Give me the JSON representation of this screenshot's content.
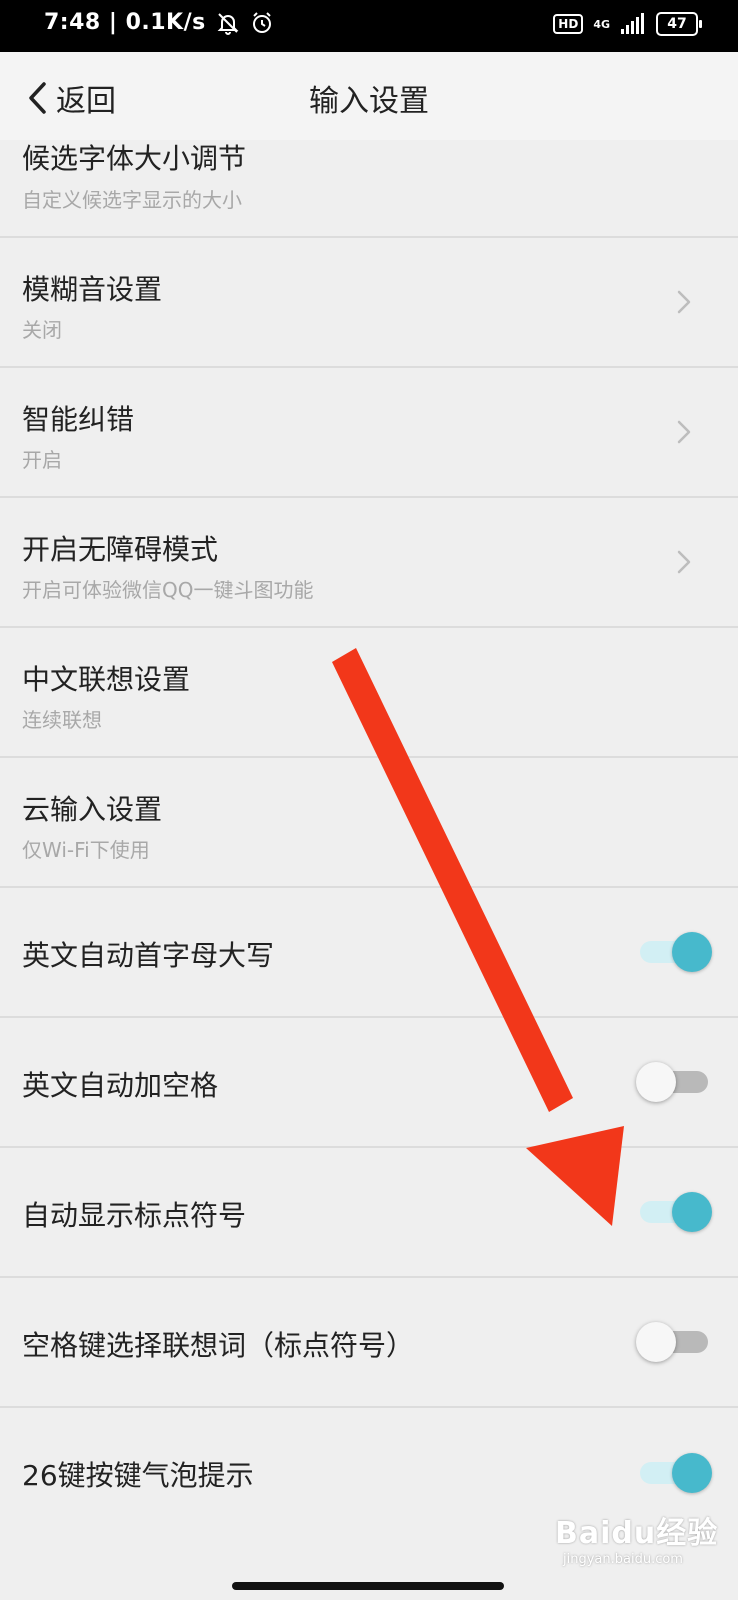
{
  "status": {
    "time_speed": "7:48 | 0.1K/s",
    "hd": "HD",
    "network": "4G",
    "battery": "47"
  },
  "header": {
    "back_label": "返回",
    "title": "输入设置"
  },
  "items": [
    {
      "title": "候选字体大小调节",
      "subtitle": "自定义候选字显示的大小"
    },
    {
      "title": "模糊音设置",
      "subtitle": "关闭"
    },
    {
      "title": "智能纠错",
      "subtitle": "开启"
    },
    {
      "title": "开启无障碍模式",
      "subtitle": "开启可体验微信QQ一键斗图功能"
    },
    {
      "title": "中文联想设置",
      "subtitle": "连续联想"
    },
    {
      "title": "云输入设置",
      "subtitle": "仅Wi-Fi下使用"
    }
  ],
  "toggles": [
    {
      "title": "英文自动首字母大写",
      "on": true
    },
    {
      "title": "英文自动加空格",
      "on": false
    },
    {
      "title": "自动显示标点符号",
      "on": true
    },
    {
      "title": "空格键选择联想词（标点符号）",
      "on": false
    },
    {
      "title": "26键按键气泡提示",
      "on": true
    }
  ],
  "watermark": {
    "brand": "Baidu经验",
    "url": "jingyan.baidu.com"
  },
  "colors": {
    "toggle_on": "#47b9cc",
    "toggle_off": "#b9b9b9",
    "annotation_arrow": "#f2371a"
  }
}
